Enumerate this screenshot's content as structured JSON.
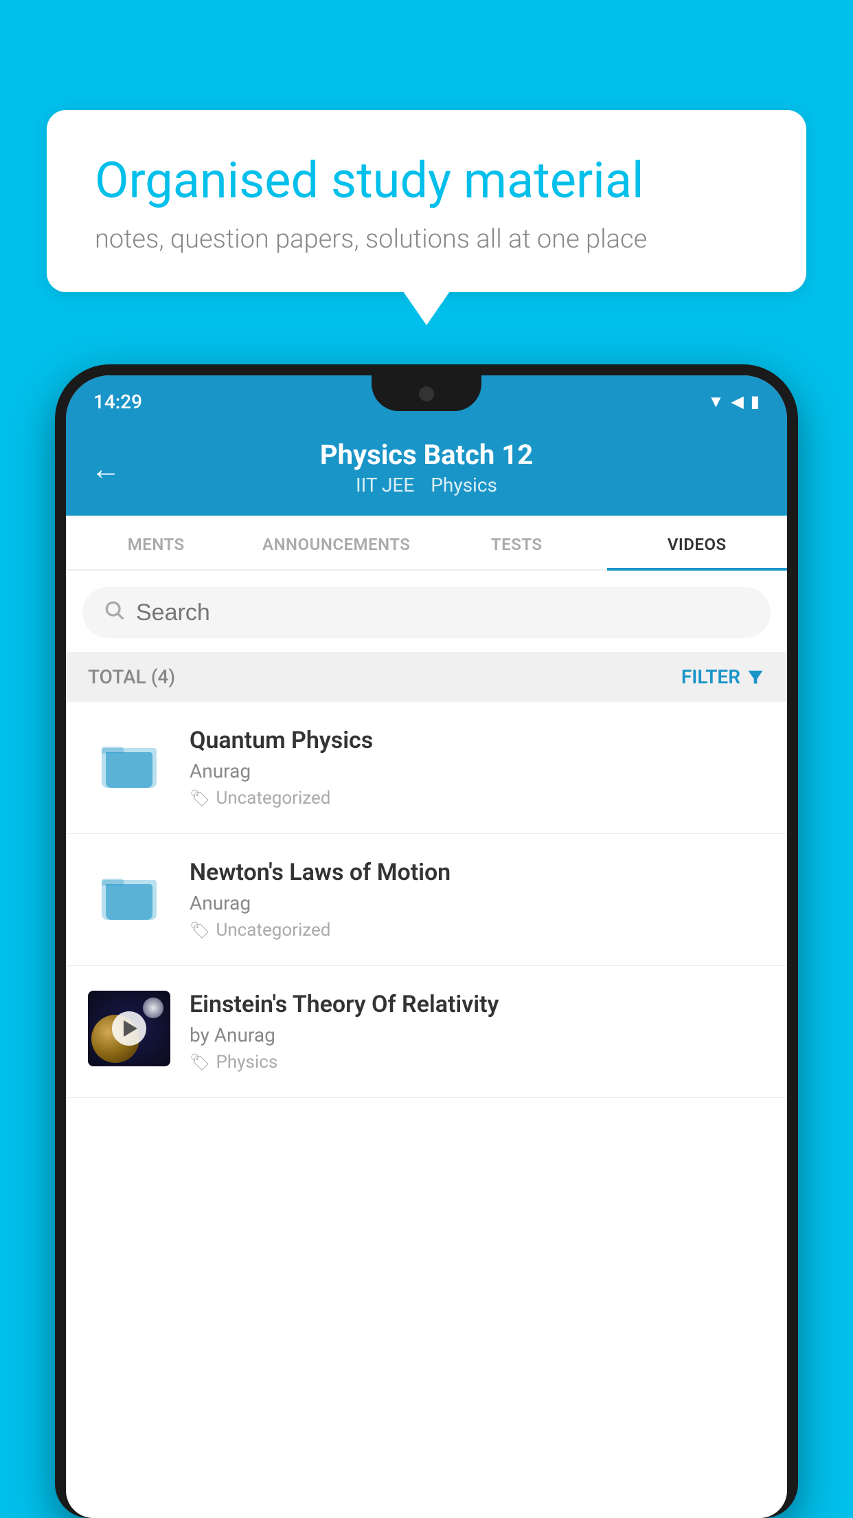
{
  "background_color": "#00BFEA",
  "speech_bubble": {
    "heading": "Organised study material",
    "subtext": "notes, question papers, solutions all at one place"
  },
  "phone": {
    "status_bar": {
      "time": "14:29",
      "icons": [
        "wifi",
        "signal",
        "battery"
      ]
    },
    "header": {
      "back_label": "←",
      "title": "Physics Batch 12",
      "tags": [
        "IIT JEE",
        "Physics"
      ]
    },
    "tabs": [
      {
        "label": "MENTS",
        "active": false
      },
      {
        "label": "ANNOUNCEMENTS",
        "active": false
      },
      {
        "label": "TESTS",
        "active": false
      },
      {
        "label": "VIDEOS",
        "active": true
      }
    ],
    "search": {
      "placeholder": "Search"
    },
    "filter_bar": {
      "total_label": "TOTAL (4)",
      "filter_label": "FILTER"
    },
    "videos": [
      {
        "id": 1,
        "title": "Quantum Physics",
        "author": "Anurag",
        "tag": "Uncategorized",
        "thumb_type": "folder"
      },
      {
        "id": 2,
        "title": "Newton's Laws of Motion",
        "author": "Anurag",
        "tag": "Uncategorized",
        "thumb_type": "folder"
      },
      {
        "id": 3,
        "title": "Einstein's Theory Of Relativity",
        "author": "by Anurag",
        "tag": "Physics",
        "thumb_type": "space"
      }
    ]
  }
}
